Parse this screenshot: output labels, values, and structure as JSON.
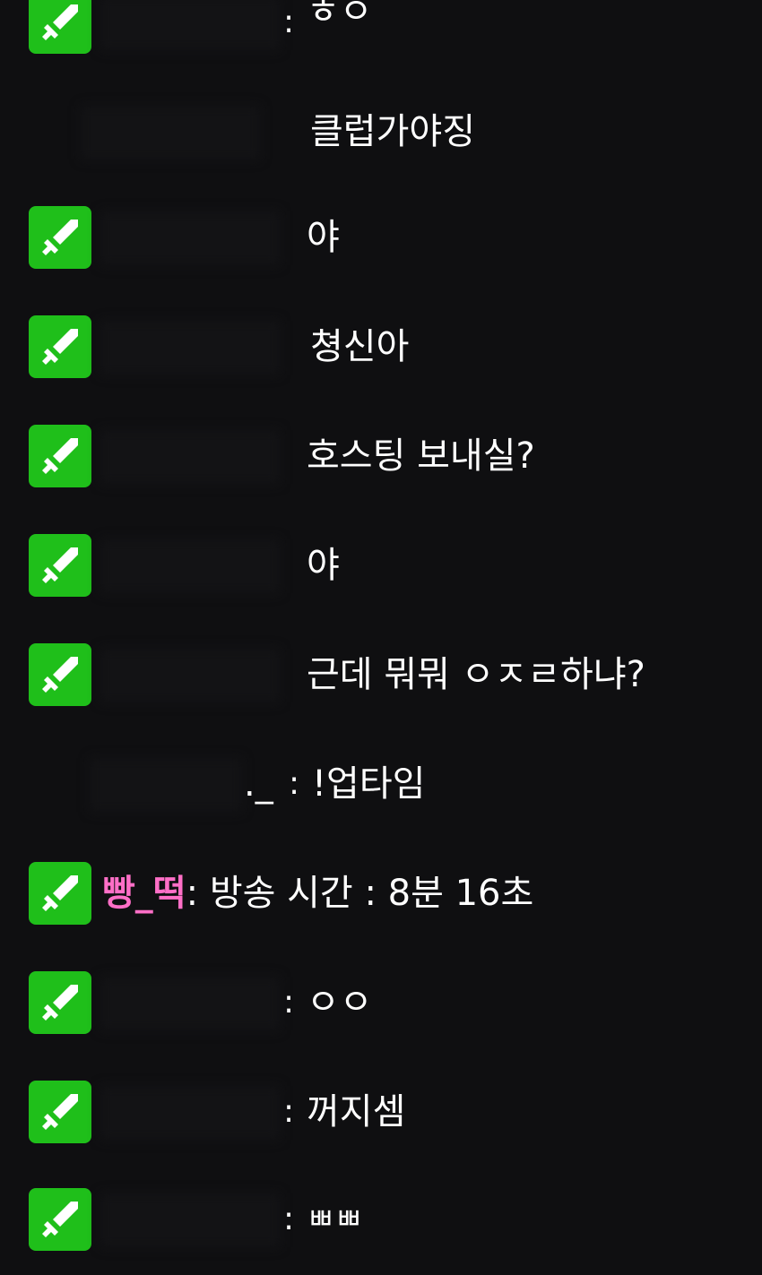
{
  "accent_badge": "#1fbf1a",
  "username_color": "#ff6fc7",
  "messages": [
    {
      "badge": "sword-icon",
      "text": "ㅎㅇ",
      "colon": ":"
    },
    {
      "badge": null,
      "text": "클럽가야징"
    },
    {
      "badge": "sword-icon",
      "text": "야"
    },
    {
      "badge": "sword-icon",
      "text": "쳥신아"
    },
    {
      "badge": "sword-icon",
      "text": "호스팅 보내실?"
    },
    {
      "badge": "sword-icon",
      "text": "야"
    },
    {
      "badge": "sword-icon",
      "text": "근데 뭐뭐 ㅇㅈㄹ하냐?"
    },
    {
      "badge": null,
      "name_tail": "._",
      "text": "!업타임",
      "colon": ":"
    },
    {
      "badge": "sword-icon",
      "username": "빵_떡",
      "text": "방송 시간 : 8분 16초",
      "colon": ":"
    },
    {
      "badge": "sword-icon",
      "text": "ㅇㅇ",
      "colon": ":"
    },
    {
      "badge": "sword-icon",
      "text": "꺼지셈",
      "colon": ":"
    },
    {
      "badge": "sword-icon",
      "text": "ㅃㅃ",
      "colon": ":"
    }
  ]
}
